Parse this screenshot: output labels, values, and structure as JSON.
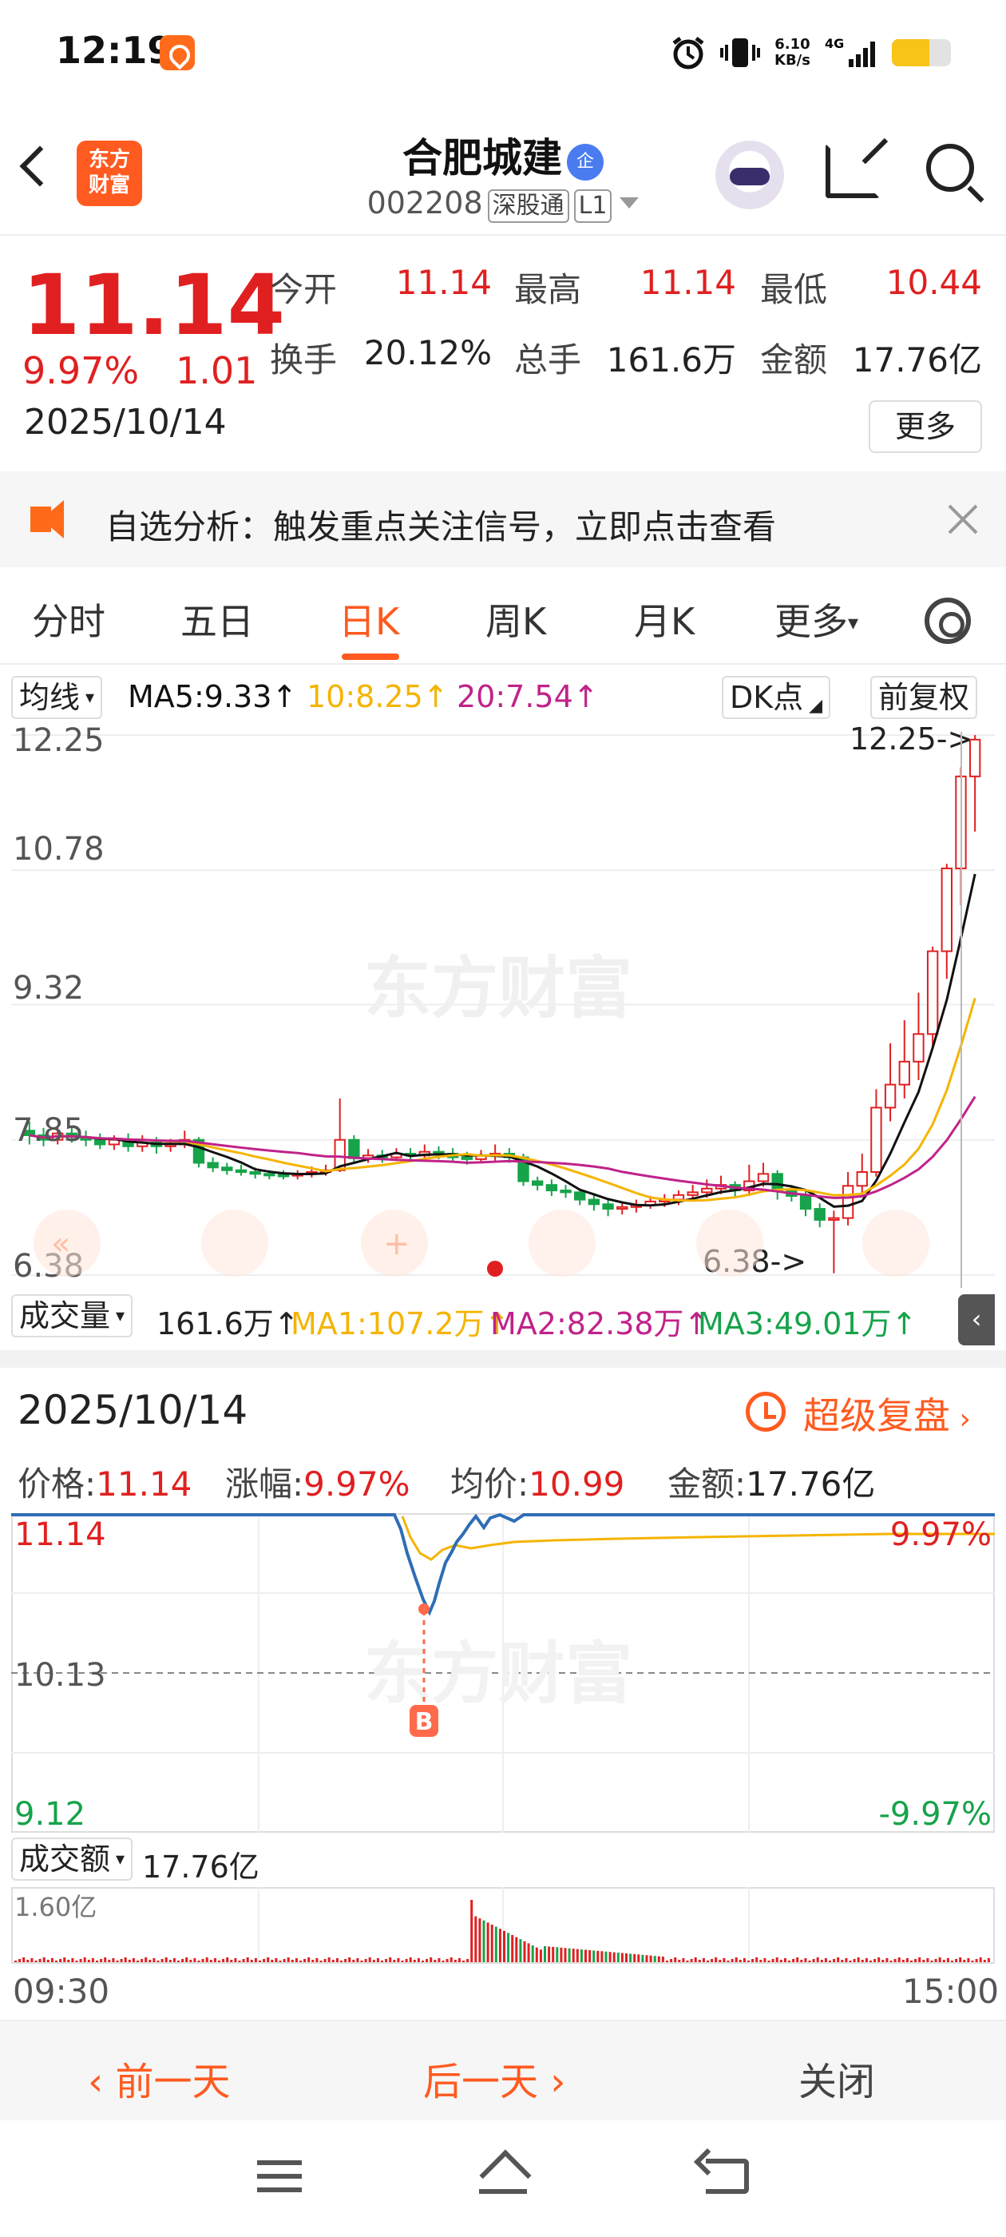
{
  "status_bar": {
    "time": "12:19",
    "net_speed": "6.10",
    "net_unit": "KB/s",
    "network": "4G",
    "battery_level": 0.6
  },
  "header": {
    "logo_line1": "东方",
    "logo_line2": "财富",
    "stock_name": "合肥城建",
    "badge": "企",
    "code": "002208",
    "tag1": "深股通",
    "tag2": "L1"
  },
  "quote": {
    "price": "11.14",
    "change_pct": "9.97%",
    "change": "1.01",
    "date": "2025/10/14",
    "open_label": "今开",
    "open": "11.14",
    "high_label": "最高",
    "high": "11.14",
    "low_label": "最低",
    "low": "10.44",
    "turnover_label": "换手",
    "turnover": "20.12%",
    "volume_label": "总手",
    "volume": "161.6万",
    "amount_label": "金额",
    "amount": "17.76亿",
    "more": "更多"
  },
  "notice": {
    "text": "自选分析：触发重点关注信号，立即点击查看"
  },
  "tabs": [
    {
      "label": "分时"
    },
    {
      "label": "五日"
    },
    {
      "label": "日K"
    },
    {
      "label": "周K"
    },
    {
      "label": "月K"
    },
    {
      "label": "更多"
    }
  ],
  "ma_row": {
    "selector": "均线",
    "ma5": "MA5:9.33↑",
    "ma10": "10:8.25↑",
    "ma20": "20:7.54↑",
    "dk": "DK点",
    "fq": "前复权"
  },
  "kchart_labels": {
    "y_ticks": [
      "12.25",
      "10.78",
      "9.32",
      "7.85",
      "6.38"
    ],
    "max_marker": "12.25->",
    "min_marker": "6.38->",
    "watermark": "东方财富"
  },
  "vol_row": {
    "selector": "成交量",
    "total": "161.6万↑",
    "ma1": "MA1:107.2万↑",
    "ma2": "MA2:82.38万↑",
    "ma3": "MA3:49.01万↑"
  },
  "detail": {
    "date": "2025/10/14",
    "replay": "超级复盘",
    "price_label": "价格:",
    "price": "11.14",
    "chg_label": "涨幅:",
    "chg": "9.97%",
    "avg_label": "均价:",
    "avg": "10.99",
    "amt_label": "金额:",
    "amt": "17.76亿",
    "y_top": "11.14",
    "y_mid": "10.13",
    "y_bot": "9.12",
    "pct_top": "9.97%",
    "pct_bot": "-9.97%",
    "b_marker": "B",
    "amount_selector": "成交额",
    "amount_total": "17.76亿",
    "amount_scale": "1.60亿",
    "time_start": "09:30",
    "time_end": "15:00"
  },
  "bottom": {
    "prev": "前一天",
    "next": "后一天",
    "close": "关闭"
  },
  "colors": {
    "up": "#e02020",
    "down": "#16a34a",
    "accent": "#ff5a1f",
    "ma5": "#111111",
    "ma10": "#f5b400",
    "ma20": "#c0228a"
  },
  "chart_data": {
    "type": "candlestick",
    "ylim": [
      6.38,
      12.25
    ],
    "y_ticks": [
      12.25,
      10.78,
      9.32,
      7.85,
      6.38
    ],
    "candles": [
      [
        7.95,
        7.9,
        8.05,
        7.8
      ],
      [
        7.9,
        7.85,
        7.98,
        7.78
      ],
      [
        7.85,
        7.92,
        8.0,
        7.8
      ],
      [
        7.92,
        7.88,
        8.0,
        7.82
      ],
      [
        7.88,
        7.85,
        7.95,
        7.78
      ],
      [
        7.85,
        7.8,
        7.92,
        7.75
      ],
      [
        7.8,
        7.85,
        7.9,
        7.74
      ],
      [
        7.85,
        7.78,
        7.92,
        7.72
      ],
      [
        7.78,
        7.82,
        7.9,
        7.72
      ],
      [
        7.82,
        7.78,
        7.88,
        7.7
      ],
      [
        7.78,
        7.8,
        7.86,
        7.72
      ],
      [
        7.8,
        7.85,
        7.95,
        7.76
      ],
      [
        7.85,
        7.6,
        7.88,
        7.55
      ],
      [
        7.6,
        7.55,
        7.66,
        7.5
      ],
      [
        7.55,
        7.52,
        7.6,
        7.47
      ],
      [
        7.52,
        7.5,
        7.58,
        7.46
      ],
      [
        7.5,
        7.48,
        7.55,
        7.43
      ],
      [
        7.48,
        7.47,
        7.52,
        7.42
      ],
      [
        7.47,
        7.46,
        7.52,
        7.42
      ],
      [
        7.46,
        7.48,
        7.52,
        7.42
      ],
      [
        7.48,
        7.5,
        7.56,
        7.44
      ],
      [
        7.5,
        7.52,
        7.58,
        7.46
      ],
      [
        7.52,
        7.85,
        8.3,
        7.5
      ],
      [
        7.85,
        7.65,
        7.9,
        7.6
      ],
      [
        7.65,
        7.68,
        7.75,
        7.6
      ],
      [
        7.68,
        7.66,
        7.74,
        7.6
      ],
      [
        7.66,
        7.7,
        7.76,
        7.62
      ],
      [
        7.7,
        7.68,
        7.76,
        7.62
      ],
      [
        7.68,
        7.72,
        7.8,
        7.64
      ],
      [
        7.72,
        7.7,
        7.78,
        7.64
      ],
      [
        7.7,
        7.66,
        7.76,
        7.6
      ],
      [
        7.66,
        7.64,
        7.72,
        7.58
      ],
      [
        7.64,
        7.68,
        7.74,
        7.6
      ],
      [
        7.68,
        7.7,
        7.8,
        7.62
      ],
      [
        7.7,
        7.66,
        7.76,
        7.6
      ],
      [
        7.66,
        7.4,
        7.7,
        7.35
      ],
      [
        7.4,
        7.36,
        7.45,
        7.3
      ],
      [
        7.36,
        7.3,
        7.42,
        7.24
      ],
      [
        7.3,
        7.28,
        7.36,
        7.22
      ],
      [
        7.28,
        7.2,
        7.32,
        7.14
      ],
      [
        7.2,
        7.15,
        7.26,
        7.08
      ],
      [
        7.15,
        7.1,
        7.2,
        7.02
      ],
      [
        7.1,
        7.12,
        7.18,
        7.04
      ],
      [
        7.12,
        7.14,
        7.2,
        7.06
      ],
      [
        7.14,
        7.18,
        7.24,
        7.1
      ],
      [
        7.18,
        7.2,
        7.26,
        7.12
      ],
      [
        7.2,
        7.25,
        7.3,
        7.14
      ],
      [
        7.25,
        7.28,
        7.36,
        7.18
      ],
      [
        7.28,
        7.32,
        7.42,
        7.22
      ],
      [
        7.32,
        7.36,
        7.46,
        7.26
      ],
      [
        7.36,
        7.3,
        7.4,
        7.22
      ],
      [
        7.3,
        7.4,
        7.58,
        7.24
      ],
      [
        7.4,
        7.48,
        7.6,
        7.34
      ],
      [
        7.48,
        7.3,
        7.52,
        7.2
      ],
      [
        7.3,
        7.24,
        7.36,
        7.18
      ],
      [
        7.24,
        7.1,
        7.3,
        7.02
      ],
      [
        7.1,
        6.98,
        7.16,
        6.9
      ],
      [
        6.98,
        7.0,
        7.08,
        6.4
      ],
      [
        7.0,
        7.35,
        7.5,
        6.92
      ],
      [
        7.35,
        7.5,
        7.7,
        7.25
      ],
      [
        7.5,
        8.2,
        8.4,
        7.45
      ],
      [
        8.2,
        8.45,
        8.9,
        8.05
      ],
      [
        8.45,
        8.7,
        9.15,
        8.3
      ],
      [
        8.7,
        9.0,
        9.45,
        8.5
      ],
      [
        9.0,
        9.9,
        9.95,
        8.85
      ],
      [
        9.9,
        10.8,
        10.85,
        9.6
      ],
      [
        10.8,
        11.8,
        11.9,
        10.4
      ],
      [
        11.8,
        12.2,
        12.25,
        11.2
      ]
    ],
    "ma5_last": 9.33,
    "ma10_last": 8.25,
    "ma20_last": 7.54,
    "intraday": {
      "ylim": [
        9.12,
        11.14
      ],
      "prev_close": 10.13
    }
  }
}
